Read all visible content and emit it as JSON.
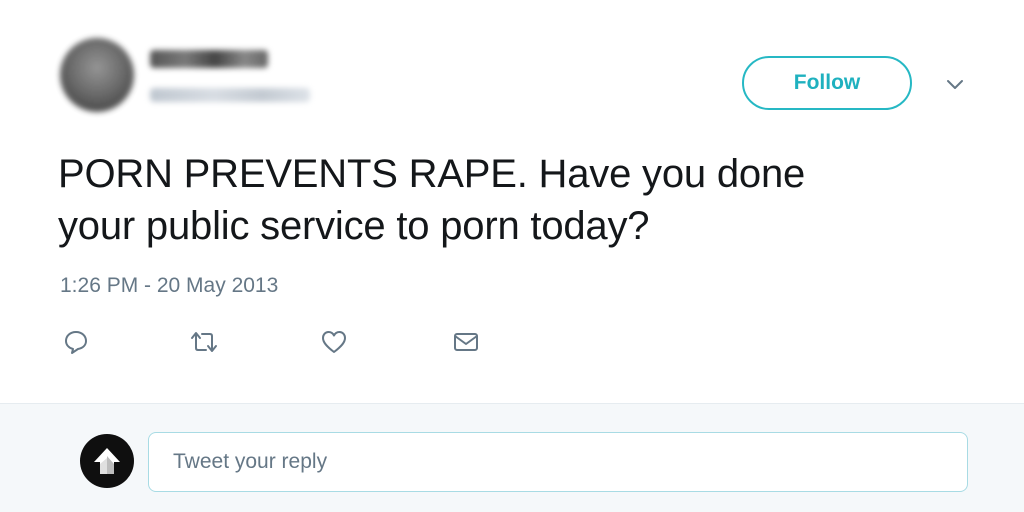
{
  "author": {
    "display_name_obscured": "Amanda",
    "handle_obscured": "@redacted"
  },
  "follow_button": {
    "label": "Follow"
  },
  "tweet": {
    "text_line1": "PORN PREVENTS RAPE. Have you done",
    "text_line2": "your public service to porn today?",
    "timestamp": "1:26 PM - 20 May 2013"
  },
  "actions": {
    "icons": [
      "reply-icon",
      "retweet-icon",
      "like-icon",
      "direct-message-icon"
    ]
  },
  "reply": {
    "placeholder": "Tweet your reply"
  },
  "colors": {
    "accent": "#1fb1bf",
    "text": "#14171a",
    "secondary": "#657786",
    "reply_bg": "#f5f8fa"
  }
}
